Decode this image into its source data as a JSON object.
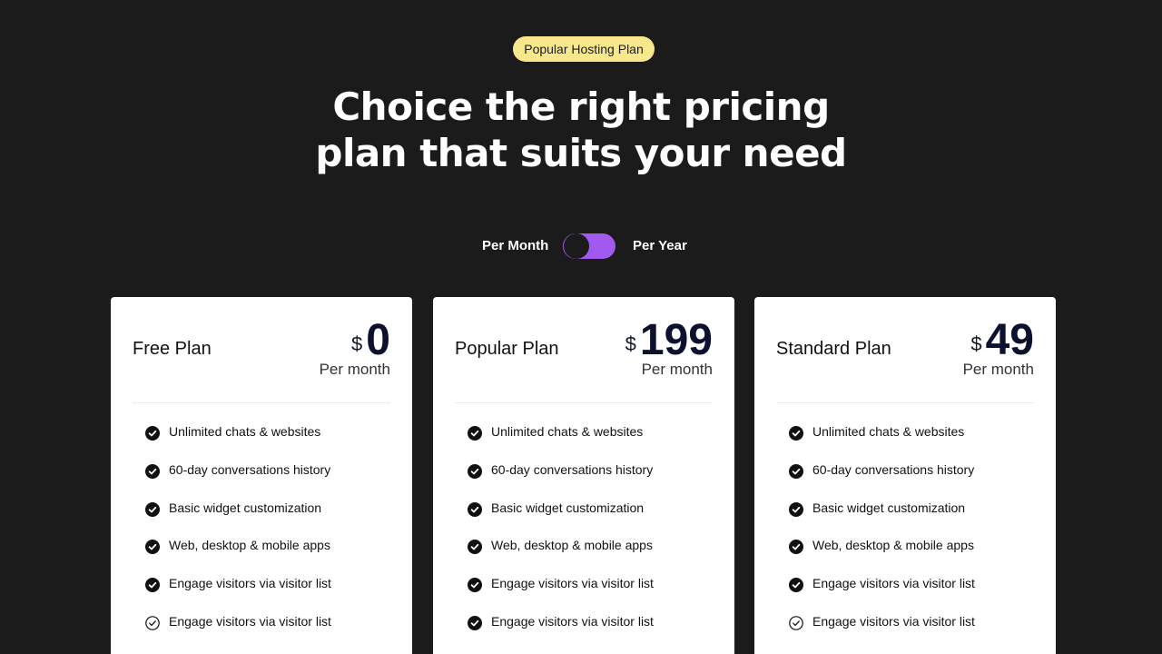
{
  "badge": "Popular Hosting Plan",
  "headline": {
    "line1": "Choice the right pricing",
    "line2": "plan that suits your need"
  },
  "billing_toggle": {
    "left_label": "Per Month",
    "right_label": "Per Year",
    "selected": "Per Year"
  },
  "colors": {
    "background": "#1c1b1c",
    "badge": "#f8e88c",
    "toggle_accent": "#a259f0",
    "card": "#ffffff",
    "price": "#0d1130"
  },
  "plans": [
    {
      "name": "Free Plan",
      "currency": "$",
      "amount": "0",
      "period": "Per month",
      "features": [
        {
          "label": "Unlimited chats & websites",
          "icon": "check-filled-icon"
        },
        {
          "label": "60-day conversations history",
          "icon": "check-filled-icon"
        },
        {
          "label": "Basic widget customization",
          "icon": "check-filled-icon"
        },
        {
          "label": "Web, desktop & mobile apps",
          "icon": "check-filled-icon"
        },
        {
          "label": "Engage visitors via visitor list",
          "icon": "check-filled-icon"
        },
        {
          "label": "Engage visitors via visitor list",
          "icon": "check-outline-icon"
        }
      ]
    },
    {
      "name": "Popular Plan",
      "currency": "$",
      "amount": "199",
      "period": "Per month",
      "features": [
        {
          "label": "Unlimited chats & websites",
          "icon": "check-filled-icon"
        },
        {
          "label": "60-day conversations history",
          "icon": "check-filled-icon"
        },
        {
          "label": "Basic widget customization",
          "icon": "check-filled-icon"
        },
        {
          "label": "Web, desktop & mobile apps",
          "icon": "check-filled-icon"
        },
        {
          "label": "Engage visitors via visitor list",
          "icon": "check-filled-icon"
        },
        {
          "label": "Engage visitors via visitor list",
          "icon": "check-filled-icon"
        }
      ]
    },
    {
      "name": "Standard Plan",
      "currency": "$",
      "amount": "49",
      "period": "Per month",
      "features": [
        {
          "label": "Unlimited chats & websites",
          "icon": "check-filled-icon"
        },
        {
          "label": "60-day conversations history",
          "icon": "check-filled-icon"
        },
        {
          "label": "Basic widget customization",
          "icon": "check-filled-icon"
        },
        {
          "label": "Web, desktop & mobile apps",
          "icon": "check-filled-icon"
        },
        {
          "label": "Engage visitors via visitor list",
          "icon": "check-filled-icon"
        },
        {
          "label": "Engage visitors via visitor list",
          "icon": "check-outline-icon"
        }
      ]
    }
  ]
}
